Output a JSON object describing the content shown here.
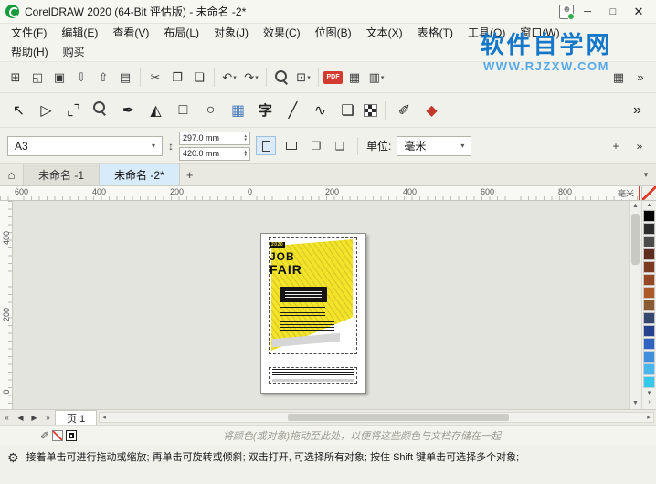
{
  "titlebar": {
    "title": "CorelDRAW 2020 (64-Bit 评估版) - 未命名 -2*",
    "minimize": "─",
    "maximize": "□",
    "close": "✕"
  },
  "menubar": {
    "row1": [
      "文件(F)",
      "编辑(E)",
      "查看(V)",
      "布局(L)",
      "对象(J)",
      "效果(C)",
      "位图(B)",
      "文本(X)",
      "表格(T)",
      "工具(O)",
      "窗口(W)"
    ],
    "row2": [
      "帮助(H)",
      "购买"
    ]
  },
  "watermark": {
    "title": "软件自学网",
    "url": "WWW.RJZXW.COM",
    "title_color": "#1577c8",
    "url_color": "#55a9e8"
  },
  "standard_toolbar": {
    "icons": [
      {
        "name": "new-document-icon",
        "glyph": "⊞"
      },
      {
        "name": "open-document-icon",
        "glyph": "◱"
      },
      {
        "name": "save-icon",
        "glyph": "▣"
      },
      {
        "name": "import-icon",
        "glyph": "⇩"
      },
      {
        "name": "export-icon",
        "glyph": "⇧"
      },
      {
        "name": "print-icon",
        "glyph": "▤"
      },
      {
        "sep": true
      },
      {
        "name": "cut-icon",
        "glyph": "✂"
      },
      {
        "name": "copy-icon",
        "glyph": "❐"
      },
      {
        "name": "paste-icon",
        "glyph": "❏"
      },
      {
        "sep": true
      },
      {
        "name": "undo-icon",
        "glyph": "↶",
        "caret": true
      },
      {
        "name": "redo-icon",
        "glyph": "↷",
        "caret": true
      },
      {
        "sep": true
      },
      {
        "name": "search-icon",
        "cls": "icon-zoom"
      },
      {
        "name": "zoom-level-dropdown",
        "glyph": "⊡",
        "caret": true
      },
      {
        "sep": true
      },
      {
        "name": "pdf-export-icon",
        "cls": "icon-pdf",
        "glyph": "PDF"
      },
      {
        "name": "show-grid-icon",
        "glyph": "▦"
      },
      {
        "name": "snap-dropdown",
        "glyph": "▥",
        "caret": true
      },
      {
        "spacer": true
      },
      {
        "name": "app-launcher-icon",
        "glyph": "▦"
      },
      {
        "name": "toolbar-overflow-icon",
        "glyph": "»"
      }
    ]
  },
  "toolbox": {
    "tools": [
      {
        "name": "pick-tool-icon",
        "glyph": "↖"
      },
      {
        "name": "shape-tool-icon",
        "glyph": "▷"
      },
      {
        "name": "crop-tool-icon",
        "glyph": "⌞⌝"
      },
      {
        "name": "zoom-tool-icon",
        "cls": "icon-zoom"
      },
      {
        "name": "curve-tool-icon",
        "glyph": "✒"
      },
      {
        "name": "artistic-media-tool-icon",
        "glyph": "◭"
      },
      {
        "name": "rectangle-tool-icon",
        "glyph": "□"
      },
      {
        "name": "ellipse-tool-icon",
        "glyph": "○"
      },
      {
        "name": "graph-paper-tool-icon",
        "glyph": "▦",
        "color": "#4a7ebb"
      },
      {
        "name": "text-tool-icon",
        "glyph": "字",
        "cls": "cn"
      },
      {
        "name": "line-tool-icon",
        "glyph": "╱"
      },
      {
        "name": "connector-tool-icon",
        "glyph": "∿"
      },
      {
        "name": "drop-shadow-tool-icon",
        "glyph": "❏"
      },
      {
        "name": "transparency-tool-icon",
        "cls": "icon-checker"
      },
      {
        "sep": true
      },
      {
        "name": "eyedropper-tool-icon",
        "glyph": "✐"
      },
      {
        "name": "smart-fill-tool-icon",
        "glyph": "◆",
        "color": "#c0392b"
      },
      {
        "spacer": true
      },
      {
        "name": "toolbox-overflow-icon",
        "glyph": "»"
      }
    ]
  },
  "property_bar": {
    "preset": "A3",
    "width_value": "297.0 mm",
    "height_value": "420.0 mm",
    "units_label": "单位:",
    "units_value": "毫米",
    "dd": "▾",
    "up": "▴",
    "down": "▾",
    "dims_icon": "↕",
    "toggle1": "❐",
    "toggle2": "❑",
    "plus": "+",
    "overflow": "»"
  },
  "document_bar": {
    "home_glyph": "⌂",
    "tabs": [
      {
        "label": "未命名 -1",
        "active": false
      },
      {
        "label": "未命名 -2*",
        "active": true
      }
    ],
    "add_label": "+",
    "chevron": "▾"
  },
  "rulers": {
    "h_numbers": [
      "600",
      "400",
      "200",
      "0",
      "200",
      "400",
      "600",
      "800"
    ],
    "v_numbers": [
      "400",
      "200",
      "0"
    ],
    "unit_label": "毫米"
  },
  "canvas": {
    "poster": {
      "year": "2020",
      "title_line1": "JOB",
      "title_line2": "FAIR",
      "accent_color": "#f2e32b"
    }
  },
  "palette": {
    "up": "▴",
    "down": "▾",
    "flyout": "›",
    "colors": [
      "#000000",
      "#2d2d2d",
      "#4c4c4c",
      "#5e2c1e",
      "#7d3a22",
      "#964826",
      "#ad5a2b",
      "#8a5a33",
      "#36486e",
      "#27418f",
      "#2e63c0",
      "#3f8fdd",
      "#49b6ee",
      "#35c8e8"
    ]
  },
  "page_nav": {
    "buttons": [
      {
        "name": "first-page-button",
        "glyph": "«"
      },
      {
        "name": "prev-page-button",
        "glyph": "◀"
      },
      {
        "name": "next-page-button",
        "glyph": "▶"
      },
      {
        "name": "last-page-button",
        "glyph": "»"
      }
    ],
    "page_tab": "页 1",
    "scroll_left": "◂",
    "scroll_right": "▸"
  },
  "hint_bar": {
    "eyedropper_glyph": "✐",
    "text": "将颜色(或对象)拖动至此处，以便将这些颜色与文档存储在一起"
  },
  "status_bar": {
    "gear_glyph": "⚙",
    "text": "接着单击可进行拖动或缩放; 再单击可旋转或倾斜; 双击打开, 可选择所有对象; 按住 Shift 键单击可选择多个对象;"
  }
}
